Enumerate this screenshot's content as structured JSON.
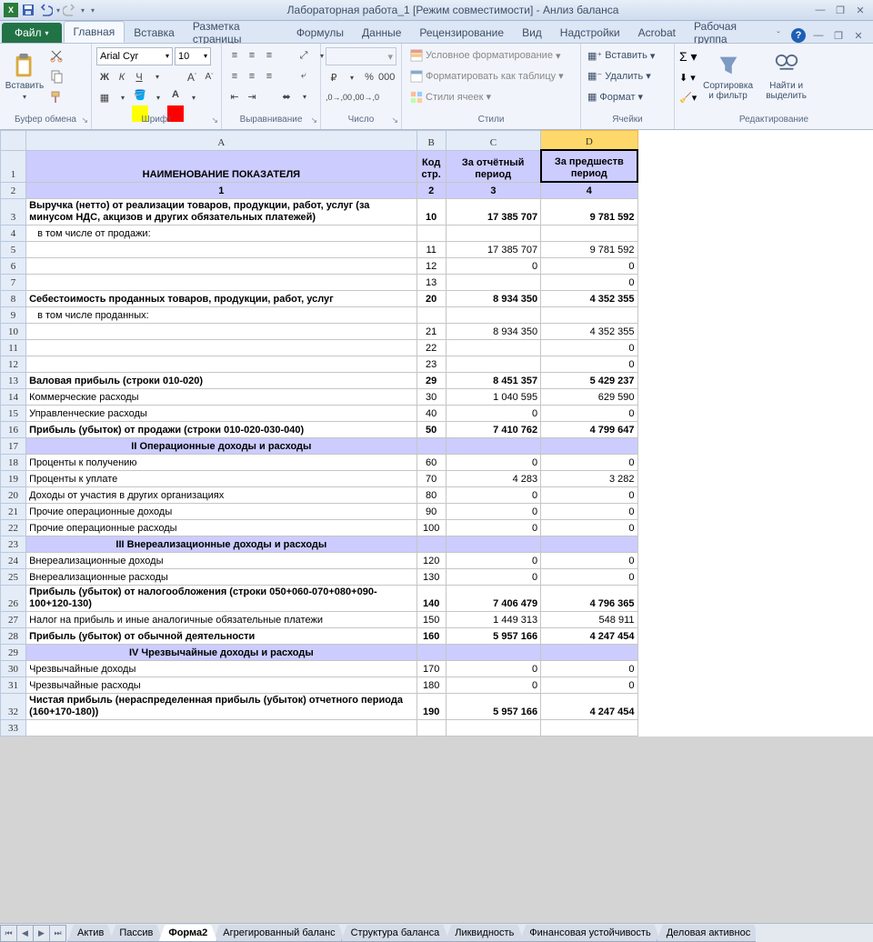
{
  "title": "Лабораторная работа_1  [Режим совместимости]  -  Анлиз баланса",
  "ribbon": {
    "file": "Файл",
    "tabs": [
      "Главная",
      "Вставка",
      "Разметка страницы",
      "Формулы",
      "Данные",
      "Рецензирование",
      "Вид",
      "Надстройки",
      "Acrobat",
      "Рабочая группа"
    ],
    "active_tab": 0,
    "groups": {
      "clipboard": {
        "label": "Буфер обмена",
        "paste": "Вставить"
      },
      "font": {
        "label": "Шрифт",
        "name": "Arial Cyr",
        "size": "10"
      },
      "align": {
        "label": "Выравнивание"
      },
      "number": {
        "label": "Число"
      },
      "styles": {
        "label": "Стили",
        "cond": "Условное форматирование",
        "table": "Форматировать как таблицу",
        "cell": "Стили ячеек"
      },
      "cells": {
        "label": "Ячейки",
        "insert": "Вставить",
        "delete": "Удалить",
        "format": "Формат"
      },
      "editing": {
        "label": "Редактирование",
        "sort": "Сортировка и фильтр",
        "find": "Найти и выделить"
      }
    }
  },
  "columns": [
    "A",
    "B",
    "C",
    "D"
  ],
  "selected_col": "D",
  "headers": {
    "a": "НАИМЕНОВАНИЕ ПОКАЗАТЕЛЯ",
    "b": "Код стр.",
    "c": "За отчётный период",
    "d": "За предшеств период"
  },
  "row2": {
    "a": "1",
    "b": "2",
    "c": "3",
    "d": "4"
  },
  "rows": [
    {
      "n": 3,
      "a": "Выручка (нетто) от реализации товаров, продукции, работ, услуг (за минусом НДС, акцизов и других обязательных платежей)",
      "b": "10",
      "c": "17 385 707",
      "d": "9 781 592",
      "b_": true,
      "tall": true
    },
    {
      "n": 4,
      "a": "в том числе от продажи:",
      "indent": true
    },
    {
      "n": 5,
      "b": "11",
      "c": "17 385 707",
      "d": "9 781 592"
    },
    {
      "n": 6,
      "b": "12",
      "c": "0",
      "d": "0"
    },
    {
      "n": 7,
      "b": "13",
      "d": "0"
    },
    {
      "n": 8,
      "a": "Себестоимость проданных товаров, продукции, работ, услуг",
      "b": "20",
      "c": "8 934 350",
      "d": "4 352 355",
      "b_": true
    },
    {
      "n": 9,
      "a": "в том числе проданных:",
      "indent": true
    },
    {
      "n": 10,
      "b": "21",
      "c": "8 934 350",
      "d": "4 352 355"
    },
    {
      "n": 11,
      "b": "22",
      "d": "0"
    },
    {
      "n": 12,
      "b": "23",
      "d": "0"
    },
    {
      "n": 13,
      "a": "Валовая прибыль (строки 010-020)",
      "b": "29",
      "c": "8 451 357",
      "d": "5 429 237",
      "b_": true
    },
    {
      "n": 14,
      "a": "Коммерческие расходы",
      "b": "30",
      "c": "1 040 595",
      "d": "629 590"
    },
    {
      "n": 15,
      "a": "Управленческие расходы",
      "b": "40",
      "c": "0",
      "d": "0"
    },
    {
      "n": 16,
      "a": "Прибыль (убыток) от продажи (строки 010-020-030-040)",
      "b": "50",
      "c": "7 410 762",
      "d": "4 799 647",
      "b_": true
    },
    {
      "n": 17,
      "a": "II Операционные доходы и расходы",
      "section": true
    },
    {
      "n": 18,
      "a": "Проценты к получению",
      "b": "60",
      "c": "0",
      "d": "0"
    },
    {
      "n": 19,
      "a": "Проценты к уплате",
      "b": "70",
      "c": "4 283",
      "d": "3 282"
    },
    {
      "n": 20,
      "a": "Доходы от участия в других организациях",
      "b": "80",
      "c": "0",
      "d": "0"
    },
    {
      "n": 21,
      "a": "Прочие операционные доходы",
      "b": "90",
      "c": "0",
      "d": "0"
    },
    {
      "n": 22,
      "a": "Прочие операционные расходы",
      "b": "100",
      "c": "0",
      "d": "0"
    },
    {
      "n": 23,
      "a": "III Внереализационные доходы и расходы",
      "section": true
    },
    {
      "n": 24,
      "a": "Внереализационные доходы",
      "b": "120",
      "c": "0",
      "d": "0"
    },
    {
      "n": 25,
      "a": "Внереализационные расходы",
      "b": "130",
      "c": "0",
      "d": "0"
    },
    {
      "n": 26,
      "a": "Прибыль (убыток) от налогообложения (строки 050+060-070+080+090-100+120-130)",
      "b": "140",
      "c": "7 406 479",
      "d": "4 796 365",
      "b_": true,
      "tall": true
    },
    {
      "n": 27,
      "a": "Налог на прибыль и иные аналогичные обязательные платежи",
      "b": "150",
      "c": "1 449 313",
      "d": "548 911"
    },
    {
      "n": 28,
      "a": "Прибыль (убыток) от обычной деятельности",
      "b": "160",
      "c": "5 957 166",
      "d": "4 247 454",
      "b_": true
    },
    {
      "n": 29,
      "a": "IV Чрезвычайные доходы и расходы",
      "section": true
    },
    {
      "n": 30,
      "a": "Чрезвычайные доходы",
      "b": "170",
      "c": "0",
      "d": "0"
    },
    {
      "n": 31,
      "a": "Чрезвычайные расходы",
      "b": "180",
      "c": "0",
      "d": "0"
    },
    {
      "n": 32,
      "a": "Чистая прибыль (нераспределенная прибыль (убыток) отчетного периода (160+170-180))",
      "b": "190",
      "c": "5 957 166",
      "d": "4 247 454",
      "b_": true,
      "tall": true
    },
    {
      "n": 33
    }
  ],
  "sheets": [
    "Актив",
    "Пассив",
    "Форма2",
    "Агрегированный баланс",
    "Структура баланса",
    "Ликвидность",
    "Финансовая устойчивость",
    "Деловая активнос"
  ],
  "active_sheet": 2
}
